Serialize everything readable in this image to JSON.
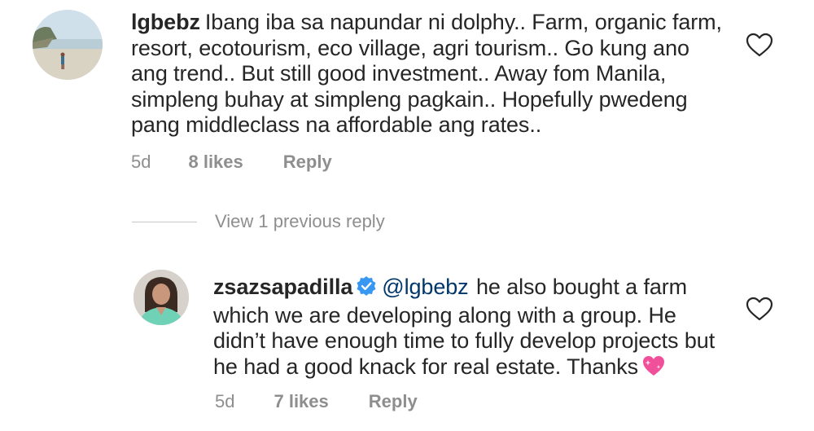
{
  "comments": [
    {
      "username": "lgbebz",
      "text_lines": [
        "Ibang iba sa napundar ni dolphy.. Farm, organic farm,",
        "resort, ecotourism, eco village, agri tourism.. Go kung ano",
        "ang trend.. But still good investment.. Away fom Manila,",
        "simpleng buhay at simpleng pagkain.. Hopefully pwedeng",
        "pang middleclass na affordable ang rates.."
      ],
      "time": "5d",
      "likes": "8 likes",
      "reply_label": "Reply",
      "avatar_icon": "beach-photo-avatar",
      "like_icon": "heart-outline-icon"
    }
  ],
  "view_replies_label": "View 1 previous reply",
  "reply": {
    "username": "zsazsapadilla",
    "verified_icon": "verified-badge-icon",
    "mention": "@lgbebz",
    "text_lines": [
      "he also bought a farm",
      "which we are developing along with a group. He",
      "didn’t have enough time to fully develop projects but",
      "he had a good knack for real estate. Thanks"
    ],
    "emoji": "pink-sparkling-heart-emoji",
    "time": "5d",
    "likes": "7 likes",
    "reply_label": "Reply",
    "avatar_icon": "portrait-photo-avatar",
    "like_icon": "heart-outline-icon"
  },
  "colors": {
    "text": "#262626",
    "meta": "#8e8e8e",
    "mention": "#00376b",
    "verified": "#3897f0",
    "emoji_heart": "#f0509a"
  }
}
